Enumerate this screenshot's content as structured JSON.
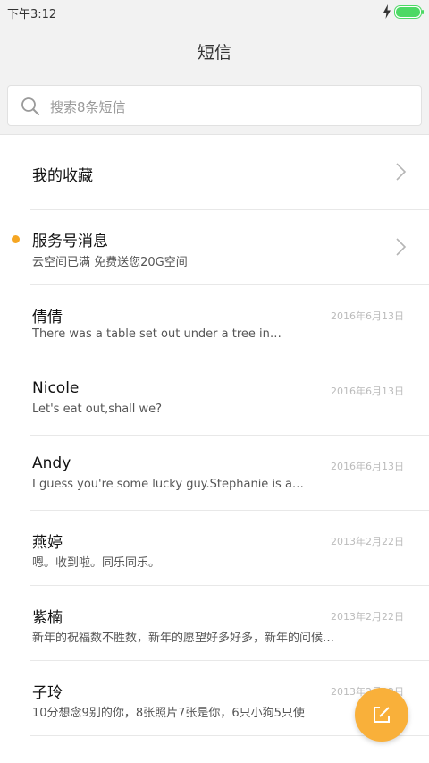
{
  "status_bar": {
    "time": "下午3:12",
    "charging_icon": "bolt-icon",
    "battery_icon": "battery-icon",
    "battery_color": "#4cd964"
  },
  "header": {
    "title": "短信"
  },
  "search": {
    "placeholder": "搜索8条短信",
    "icon": "search-icon"
  },
  "accent_color": "#f5a623",
  "rows": [
    {
      "title": "我的收藏",
      "subtitle": "",
      "date": "",
      "chevron": true,
      "unread": false
    },
    {
      "title": "服务号消息",
      "subtitle": "云空间已满 免费送您20G空间",
      "date": "",
      "chevron": true,
      "unread": true
    },
    {
      "title": "倩倩",
      "subtitle": "There was a table set out under a tree in…",
      "date": "2016年6月13日",
      "chevron": false,
      "unread": false
    },
    {
      "title": "Nicole",
      "subtitle": "Let's eat out,shall we?",
      "date": "2016年6月13日",
      "chevron": false,
      "unread": false
    },
    {
      "title": "Andy",
      "subtitle": "I guess you're some lucky guy.Stephanie is a…",
      "date": "2016年6月13日",
      "chevron": false,
      "unread": false
    },
    {
      "title": "燕婷",
      "subtitle": "嗯。收到啦。同乐同乐。",
      "date": "2013年2月22日",
      "chevron": false,
      "unread": false
    },
    {
      "title": "紫楠",
      "subtitle": "新年的祝福数不胜数，新年的愿望好多好多，新年的问候…",
      "date": "2013年2月22日",
      "chevron": false,
      "unread": false
    },
    {
      "title": "子玲",
      "subtitle": "10分想念9别的你，8张照片7张是你，6只小狗5只使",
      "date": "2013年2月22日",
      "chevron": false,
      "unread": false
    }
  ],
  "fab": {
    "icon": "compose-icon",
    "color": "#f9b03a"
  }
}
